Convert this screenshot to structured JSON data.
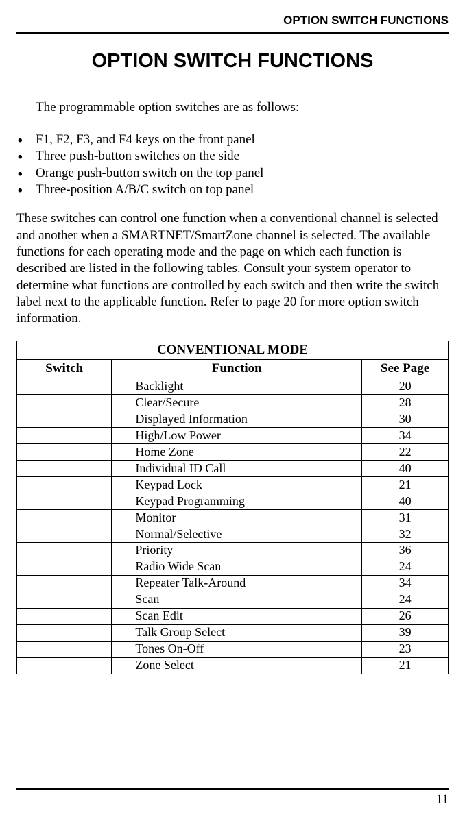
{
  "header_label": "OPTION SWITCH FUNCTIONS",
  "title": "OPTION SWITCH FUNCTIONS",
  "intro": "The programmable option switches are as follows:",
  "switches": [
    "F1, F2, F3, and F4 keys on the front panel",
    "Three push-button switches on the side",
    "Orange push-button switch on the top panel",
    "Three-position A/B/C switch on top panel"
  ],
  "explain": "These switches can control one function when a conventional channel is selected and another when a SMARTNET/SmartZone channel is selected. The available functions for each operating mode and the page on which each function is described are listed in the following tables. Consult your system operator to determine what functions are controlled by each switch and then write the switch label next to the applicable function. Refer to page 20 for more option switch information.",
  "table": {
    "mode": "CONVENTIONAL MODE",
    "columns": {
      "switch": "Switch",
      "function": "Function",
      "page": "See Page"
    },
    "rows": [
      {
        "switch": "",
        "function": "Backlight",
        "page": "20"
      },
      {
        "switch": "",
        "function": "Clear/Secure",
        "page": "28"
      },
      {
        "switch": "",
        "function": "Displayed Information",
        "page": "30"
      },
      {
        "switch": "",
        "function": "High/Low Power",
        "page": "34"
      },
      {
        "switch": "",
        "function": "Home Zone",
        "page": "22"
      },
      {
        "switch": "",
        "function": "Individual ID Call",
        "page": "40"
      },
      {
        "switch": "",
        "function": "Keypad Lock",
        "page": "21"
      },
      {
        "switch": "",
        "function": "Keypad Programming",
        "page": "40"
      },
      {
        "switch": "",
        "function": "Monitor",
        "page": "31"
      },
      {
        "switch": "",
        "function": "Normal/Selective",
        "page": "32"
      },
      {
        "switch": "",
        "function": "Priority",
        "page": "36"
      },
      {
        "switch": "",
        "function": "Radio Wide Scan",
        "page": "24"
      },
      {
        "switch": "",
        "function": "Repeater Talk-Around",
        "page": "34"
      },
      {
        "switch": "",
        "function": "Scan",
        "page": "24"
      },
      {
        "switch": "",
        "function": "Scan Edit",
        "page": "26"
      },
      {
        "switch": "",
        "function": "Talk Group Select",
        "page": "39"
      },
      {
        "switch": "",
        "function": "Tones On-Off",
        "page": "23"
      },
      {
        "switch": "",
        "function": "Zone Select",
        "page": "21"
      }
    ]
  },
  "page_number": "11",
  "chart_data": {
    "type": "table",
    "title": "CONVENTIONAL MODE",
    "columns": [
      "Switch",
      "Function",
      "See Page"
    ],
    "rows": [
      [
        "",
        "Backlight",
        20
      ],
      [
        "",
        "Clear/Secure",
        28
      ],
      [
        "",
        "Displayed Information",
        30
      ],
      [
        "",
        "High/Low Power",
        34
      ],
      [
        "",
        "Home Zone",
        22
      ],
      [
        "",
        "Individual ID Call",
        40
      ],
      [
        "",
        "Keypad Lock",
        21
      ],
      [
        "",
        "Keypad Programming",
        40
      ],
      [
        "",
        "Monitor",
        31
      ],
      [
        "",
        "Normal/Selective",
        32
      ],
      [
        "",
        "Priority",
        36
      ],
      [
        "",
        "Radio Wide Scan",
        24
      ],
      [
        "",
        "Repeater Talk-Around",
        34
      ],
      [
        "",
        "Scan",
        24
      ],
      [
        "",
        "Scan Edit",
        26
      ],
      [
        "",
        "Talk Group Select",
        39
      ],
      [
        "",
        "Tones On-Off",
        23
      ],
      [
        "",
        "Zone Select",
        21
      ]
    ]
  }
}
